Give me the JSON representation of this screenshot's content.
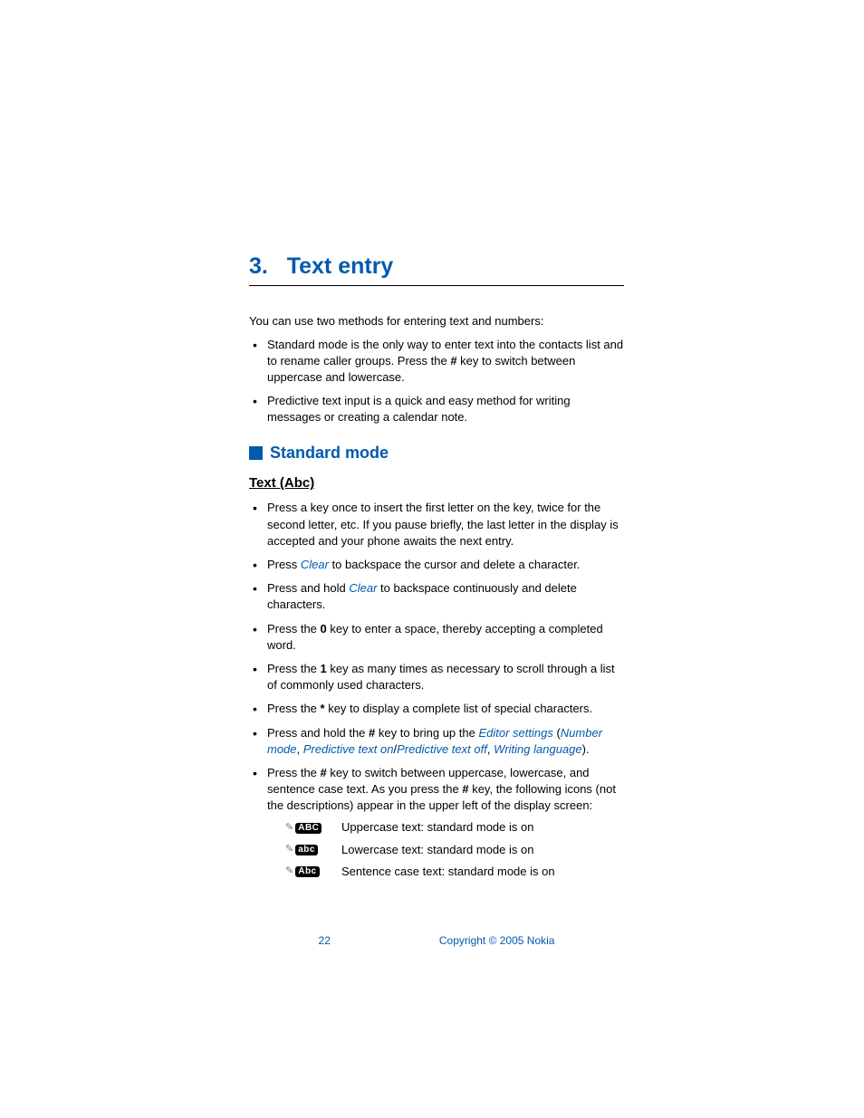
{
  "chapter": {
    "number": "3.",
    "title": "Text entry"
  },
  "intro": "You can use two methods for entering text and numbers:",
  "methods": [
    {
      "pre": "Standard mode is the only way to enter text into the contacts list and to rename caller groups. Press the ",
      "bold1": "#",
      "post": " key to switch between uppercase and lowercase."
    },
    {
      "text": "Predictive text input is a quick and easy method for writing messages or creating a calendar note."
    }
  ],
  "section1": {
    "title": "Standard mode"
  },
  "subsection1": {
    "title": "Text (Abc)"
  },
  "bullets": {
    "b1": "Press a key once to insert the first letter on the key, twice for the second letter, etc. If you pause briefly, the last letter in the display is accepted and your phone awaits the next entry.",
    "b2": {
      "pre": "Press ",
      "link": "Clear",
      "post": " to backspace the cursor and delete a character."
    },
    "b3": {
      "pre": "Press and hold ",
      "link": "Clear",
      "post": " to backspace continuously and delete characters."
    },
    "b4": {
      "pre": "Press the ",
      "bold": "0",
      "post": " key to enter a space, thereby accepting a completed word."
    },
    "b5": {
      "pre": "Press the ",
      "bold": "1",
      "post": " key as many times as necessary to scroll through a list of commonly used characters."
    },
    "b6": {
      "pre": "Press the ",
      "bold": "*",
      "post": " key to display a complete list of special characters."
    },
    "b7": {
      "pre": "Press and hold the ",
      "bold": "#",
      "mid1": " key to bring up the ",
      "link1": "Editor settings",
      "open": " (",
      "link2": "Number mode",
      "sep1": ", ",
      "link3": "Predictive text on",
      "slash": "/",
      "link4": "Predictive text off",
      "sep2": ", ",
      "link5": "Writing language",
      "close": ")."
    },
    "b8": {
      "pre": "Press the ",
      "bold1": "#",
      "mid": " key to switch between uppercase, lowercase, and sentence case text. As you press the ",
      "bold2": "#",
      "post": " key, the following icons (not the descriptions) appear in the upper left of the display screen:"
    }
  },
  "icons": {
    "upper": {
      "glyph": "ABC",
      "desc": "Uppercase text: standard mode is on"
    },
    "lower": {
      "glyph": "abc",
      "desc": "Lowercase text: standard mode is on"
    },
    "sentence": {
      "glyph": "Abc",
      "desc": "Sentence case text: standard mode is on"
    }
  },
  "footer": {
    "page": "22",
    "copyright": "Copyright © 2005 Nokia"
  }
}
